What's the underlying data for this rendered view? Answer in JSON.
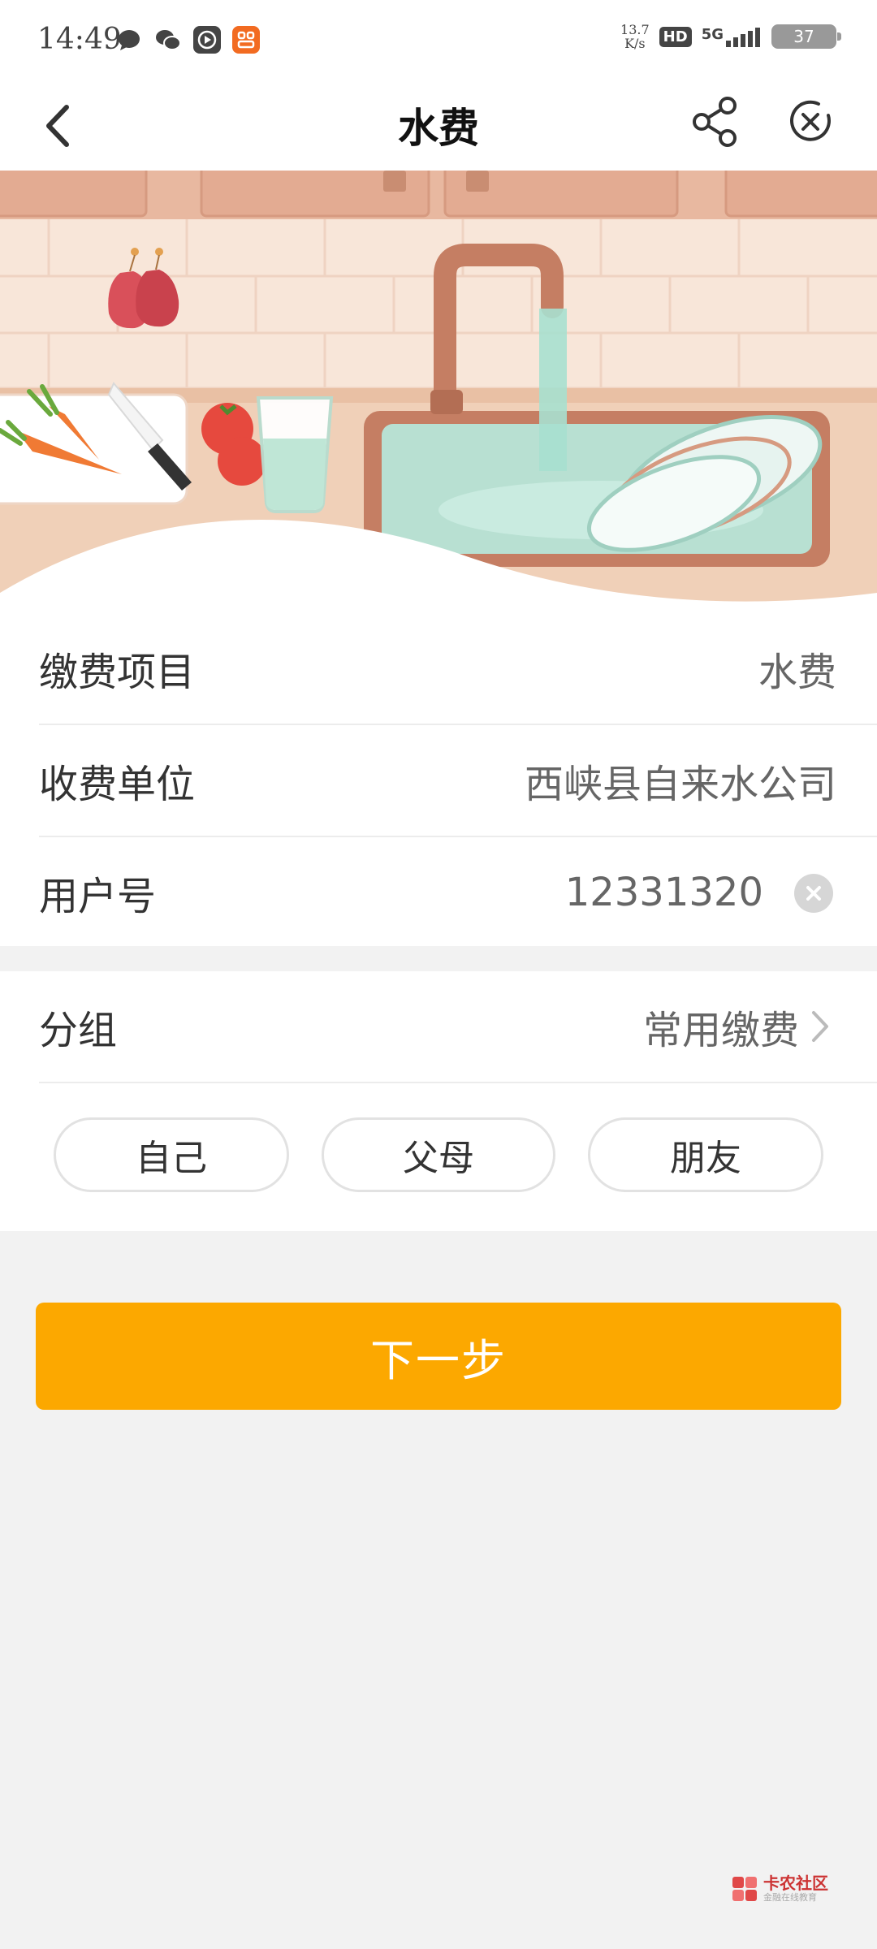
{
  "status_bar": {
    "time": "14:49",
    "speed_value": "13.7",
    "speed_unit": "K/s",
    "hd": "HD",
    "network": "5G",
    "battery": "37"
  },
  "header": {
    "title": "水费",
    "back_icon": "chevron-left-icon",
    "share_icon": "share-icon",
    "close_icon": "close-circle-icon"
  },
  "form": {
    "item": {
      "label": "缴费项目",
      "value": "水费"
    },
    "payee": {
      "label": "收费单位",
      "value": "西峡县自来水公司"
    },
    "account": {
      "label": "用户号",
      "value": "12331320"
    }
  },
  "group": {
    "label": "分组",
    "value": "常用缴费",
    "chips": [
      "自己",
      "父母",
      "朋友"
    ]
  },
  "next_button": "下一步",
  "watermark": {
    "title": "卡农社区",
    "subtitle": "金融在线教育"
  },
  "colors": {
    "accent": "#fca800",
    "background": "#f2f2f2"
  }
}
